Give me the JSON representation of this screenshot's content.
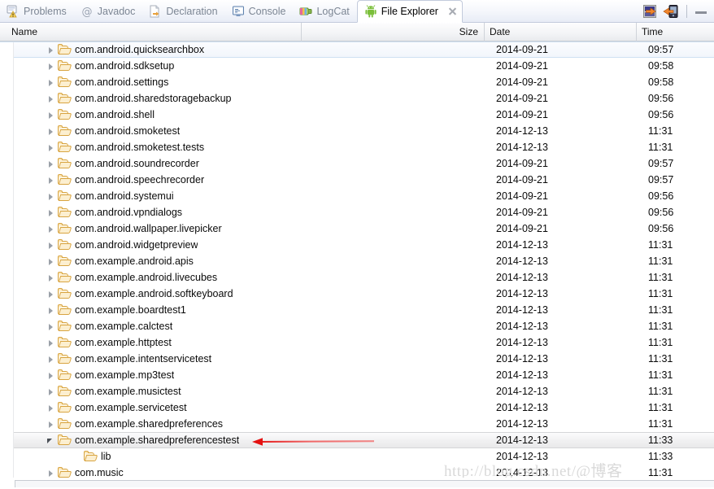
{
  "tabs": [
    {
      "label": "Problems",
      "icon": "problems-icon",
      "active": false
    },
    {
      "label": "Javadoc",
      "icon": "javadoc-icon",
      "active": false
    },
    {
      "label": "Declaration",
      "icon": "declaration-icon",
      "active": false
    },
    {
      "label": "Console",
      "icon": "console-icon",
      "active": false
    },
    {
      "label": "LogCat",
      "icon": "logcat-icon",
      "active": false
    },
    {
      "label": "File Explorer",
      "icon": "android-icon",
      "active": true
    }
  ],
  "toolbar": {
    "pull_file_label": "Pull a file from the device",
    "push_file_label": "Push a file onto the device",
    "minimize_label": "Minimize"
  },
  "columns": {
    "name": "Name",
    "size": "Size",
    "date": "Date",
    "time": "Time"
  },
  "rows": [
    {
      "name": "com.android.quicksearchbox",
      "size": "",
      "date": "2014-09-21",
      "time": "09:57",
      "indent": 1,
      "twisty": "collapsed",
      "state": "focus"
    },
    {
      "name": "com.android.sdksetup",
      "size": "",
      "date": "2014-09-21",
      "time": "09:58",
      "indent": 1,
      "twisty": "collapsed",
      "state": ""
    },
    {
      "name": "com.android.settings",
      "size": "",
      "date": "2014-09-21",
      "time": "09:58",
      "indent": 1,
      "twisty": "collapsed",
      "state": ""
    },
    {
      "name": "com.android.sharedstoragebackup",
      "size": "",
      "date": "2014-09-21",
      "time": "09:56",
      "indent": 1,
      "twisty": "collapsed",
      "state": ""
    },
    {
      "name": "com.android.shell",
      "size": "",
      "date": "2014-09-21",
      "time": "09:56",
      "indent": 1,
      "twisty": "collapsed",
      "state": ""
    },
    {
      "name": "com.android.smoketest",
      "size": "",
      "date": "2014-12-13",
      "time": "11:31",
      "indent": 1,
      "twisty": "collapsed",
      "state": ""
    },
    {
      "name": "com.android.smoketest.tests",
      "size": "",
      "date": "2014-12-13",
      "time": "11:31",
      "indent": 1,
      "twisty": "collapsed",
      "state": ""
    },
    {
      "name": "com.android.soundrecorder",
      "size": "",
      "date": "2014-09-21",
      "time": "09:57",
      "indent": 1,
      "twisty": "collapsed",
      "state": ""
    },
    {
      "name": "com.android.speechrecorder",
      "size": "",
      "date": "2014-09-21",
      "time": "09:57",
      "indent": 1,
      "twisty": "collapsed",
      "state": ""
    },
    {
      "name": "com.android.systemui",
      "size": "",
      "date": "2014-09-21",
      "time": "09:56",
      "indent": 1,
      "twisty": "collapsed",
      "state": ""
    },
    {
      "name": "com.android.vpndialogs",
      "size": "",
      "date": "2014-09-21",
      "time": "09:56",
      "indent": 1,
      "twisty": "collapsed",
      "state": ""
    },
    {
      "name": "com.android.wallpaper.livepicker",
      "size": "",
      "date": "2014-09-21",
      "time": "09:56",
      "indent": 1,
      "twisty": "collapsed",
      "state": ""
    },
    {
      "name": "com.android.widgetpreview",
      "size": "",
      "date": "2014-12-13",
      "time": "11:31",
      "indent": 1,
      "twisty": "collapsed",
      "state": ""
    },
    {
      "name": "com.example.android.apis",
      "size": "",
      "date": "2014-12-13",
      "time": "11:31",
      "indent": 1,
      "twisty": "collapsed",
      "state": ""
    },
    {
      "name": "com.example.android.livecubes",
      "size": "",
      "date": "2014-12-13",
      "time": "11:31",
      "indent": 1,
      "twisty": "collapsed",
      "state": ""
    },
    {
      "name": "com.example.android.softkeyboard",
      "size": "",
      "date": "2014-12-13",
      "time": "11:31",
      "indent": 1,
      "twisty": "collapsed",
      "state": ""
    },
    {
      "name": "com.example.boardtest1",
      "size": "",
      "date": "2014-12-13",
      "time": "11:31",
      "indent": 1,
      "twisty": "collapsed",
      "state": ""
    },
    {
      "name": "com.example.calctest",
      "size": "",
      "date": "2014-12-13",
      "time": "11:31",
      "indent": 1,
      "twisty": "collapsed",
      "state": ""
    },
    {
      "name": "com.example.httptest",
      "size": "",
      "date": "2014-12-13",
      "time": "11:31",
      "indent": 1,
      "twisty": "collapsed",
      "state": ""
    },
    {
      "name": "com.example.intentservicetest",
      "size": "",
      "date": "2014-12-13",
      "time": "11:31",
      "indent": 1,
      "twisty": "collapsed",
      "state": ""
    },
    {
      "name": "com.example.mp3test",
      "size": "",
      "date": "2014-12-13",
      "time": "11:31",
      "indent": 1,
      "twisty": "collapsed",
      "state": ""
    },
    {
      "name": "com.example.musictest",
      "size": "",
      "date": "2014-12-13",
      "time": "11:31",
      "indent": 1,
      "twisty": "collapsed",
      "state": ""
    },
    {
      "name": "com.example.servicetest",
      "size": "",
      "date": "2014-12-13",
      "time": "11:31",
      "indent": 1,
      "twisty": "collapsed",
      "state": ""
    },
    {
      "name": "com.example.sharedpreferences",
      "size": "",
      "date": "2014-12-13",
      "time": "11:31",
      "indent": 1,
      "twisty": "collapsed",
      "state": ""
    },
    {
      "name": "com.example.sharedpreferencestest",
      "size": "",
      "date": "2014-12-13",
      "time": "11:33",
      "indent": 1,
      "twisty": "expanded",
      "state": "selected"
    },
    {
      "name": "lib",
      "size": "",
      "date": "2014-12-13",
      "time": "11:33",
      "indent": 2,
      "twisty": "none",
      "state": ""
    },
    {
      "name": "com.music",
      "size": "",
      "date": "2014-12-13",
      "time": "11:31",
      "indent": 1,
      "twisty": "collapsed",
      "state": ""
    }
  ],
  "annotation": {
    "arrow_color": "#ee2222",
    "arrow_direction": "left"
  },
  "watermark": {
    "text": "http://blog.csdn.net/@博客"
  }
}
